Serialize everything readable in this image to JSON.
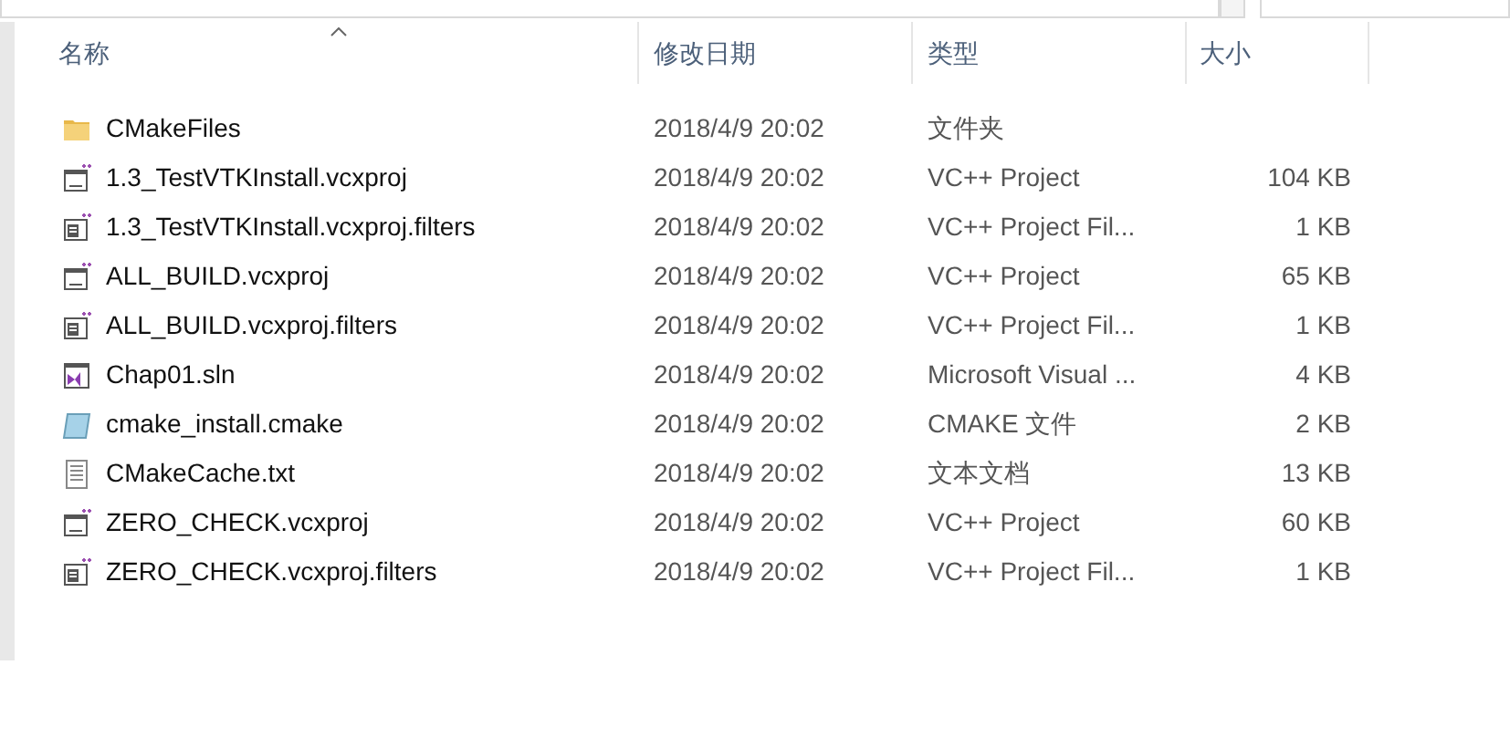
{
  "columns": [
    {
      "label": "名称",
      "sorted": true
    },
    {
      "label": "修改日期",
      "sorted": false
    },
    {
      "label": "类型",
      "sorted": false
    },
    {
      "label": "大小",
      "sorted": false
    }
  ],
  "files": [
    {
      "kind": "folder",
      "name": "CMakeFiles",
      "modified": "2018/4/9 20:02",
      "type": "文件夹"
    },
    {
      "kind": "vcxproj",
      "name": "1.3_TestVTKInstall.vcxproj",
      "modified": "2018/4/9 20:02",
      "type": "VC++ Project",
      "size": "104 KB"
    },
    {
      "kind": "filters",
      "name": "1.3_TestVTKInstall.vcxproj.filters",
      "modified": "2018/4/9 20:02",
      "type": "VC++ Project Fil...",
      "size": "1 KB"
    },
    {
      "kind": "vcxproj",
      "name": "ALL_BUILD.vcxproj",
      "modified": "2018/4/9 20:02",
      "type": "VC++ Project",
      "size": "65 KB"
    },
    {
      "kind": "filters",
      "name": "ALL_BUILD.vcxproj.filters",
      "modified": "2018/4/9 20:02",
      "type": "VC++ Project Fil...",
      "size": "1 KB"
    },
    {
      "kind": "sln",
      "name": "Chap01.sln",
      "modified": "2018/4/9 20:02",
      "type": "Microsoft Visual ...",
      "size": "4 KB"
    },
    {
      "kind": "cmake",
      "name": "cmake_install.cmake",
      "modified": "2018/4/9 20:02",
      "type": "CMAKE 文件",
      "size": "2 KB"
    },
    {
      "kind": "txt",
      "name": "CMakeCache.txt",
      "modified": "2018/4/9 20:02",
      "type": "文本文档",
      "size": "13 KB"
    },
    {
      "kind": "vcxproj",
      "name": "ZERO_CHECK.vcxproj",
      "modified": "2018/4/9 20:02",
      "type": "VC++ Project",
      "size": "60 KB"
    },
    {
      "kind": "filters",
      "name": "ZERO_CHECK.vcxproj.filters",
      "modified": "2018/4/9 20:02",
      "type": "VC++ Project Fil...",
      "size": "1 KB"
    }
  ]
}
